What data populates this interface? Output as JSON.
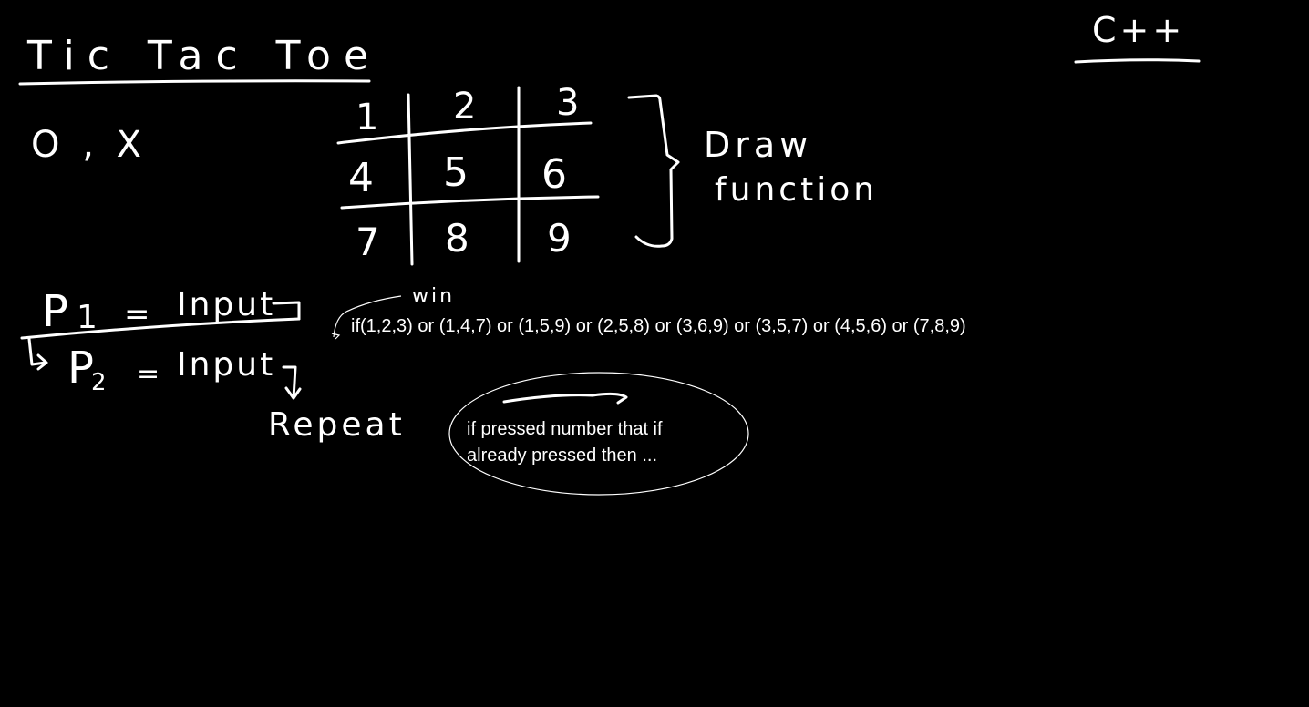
{
  "title": "Tic Tac Toe",
  "language": "C++",
  "symbols": "O , X",
  "grid": [
    "1",
    "2",
    "3",
    "4",
    "5",
    "6",
    "7",
    "8",
    "9"
  ],
  "draw_label_1": "Draw",
  "draw_label_2": "function",
  "player1": {
    "name": "P",
    "subscript": "1",
    "equals": "=",
    "value": "Input"
  },
  "player2": {
    "name": "P",
    "subscript": "2",
    "equals": "=",
    "value": "Input"
  },
  "repeat": "Repeat",
  "win_label": "win",
  "win_condition": "if(1,2,3) or (1,4,7) or (1,5,9) or (2,5,8) or (3,6,9) or (3,5,7) or (4,5,6) or (7,8,9)",
  "note_line_1": "if pressed number that if",
  "note_line_2": "already pressed then ...",
  "colors": {
    "background": "#000000",
    "ink": "#ffffff"
  }
}
